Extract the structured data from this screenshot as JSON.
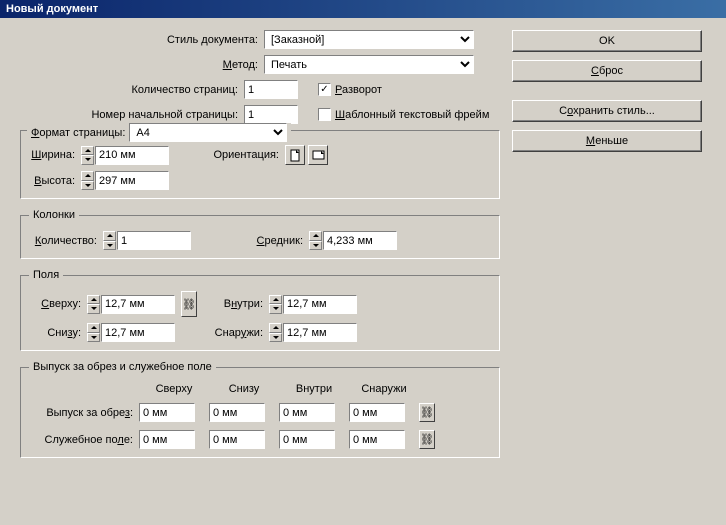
{
  "title": "Новый документ",
  "labels": {
    "docStyle": "Стиль документа:",
    "method": "Метод:",
    "pageCount": "Количество страниц:",
    "startPage": "Номер начальной страницы:",
    "spread": "Разворот",
    "masterFrame": "Шаблонный текстовый фрейм",
    "pageFormat": "Формат страницы:",
    "width": "Ширина:",
    "height": "Высота:",
    "orientation": "Ориентация:",
    "columnsGroup": "Колонки",
    "columnCount": "Количество:",
    "gutter": "Средник:",
    "marginsGroup": "Поля",
    "top": "Сверху:",
    "bottom": "Снизу:",
    "inside": "Внутри:",
    "outside": "Снаружи:",
    "bleedGroup": "Выпуск за обрез и служебное поле",
    "hdrTop": "Сверху",
    "hdrBottom": "Снизу",
    "hdrInside": "Внутри",
    "hdrOutside": "Снаружи",
    "bleed": "Выпуск за обрез:",
    "slug": "Служебное поле:"
  },
  "values": {
    "docStyle": "[Заказной]",
    "method": "Печать",
    "pageCount": "1",
    "startPage": "1",
    "spreadChecked": true,
    "masterChecked": false,
    "pageFormat": "A4",
    "width": "210 мм",
    "height": "297 мм",
    "columns": "1",
    "gutter": "4,233 мм",
    "marginTop": "12,7 мм",
    "marginBottom": "12,7 мм",
    "marginInside": "12,7 мм",
    "marginOutside": "12,7 мм",
    "bleedTop": "0 мм",
    "bleedBottom": "0 мм",
    "bleedInside": "0 мм",
    "bleedOutside": "0 мм",
    "slugTop": "0 мм",
    "slugBottom": "0 мм",
    "slugInside": "0 мм",
    "slugOutside": "0 мм"
  },
  "buttons": {
    "ok": "OK",
    "reset": "Сброс",
    "saveStyle": "Сохранить стиль...",
    "fewer": "Меньше"
  }
}
